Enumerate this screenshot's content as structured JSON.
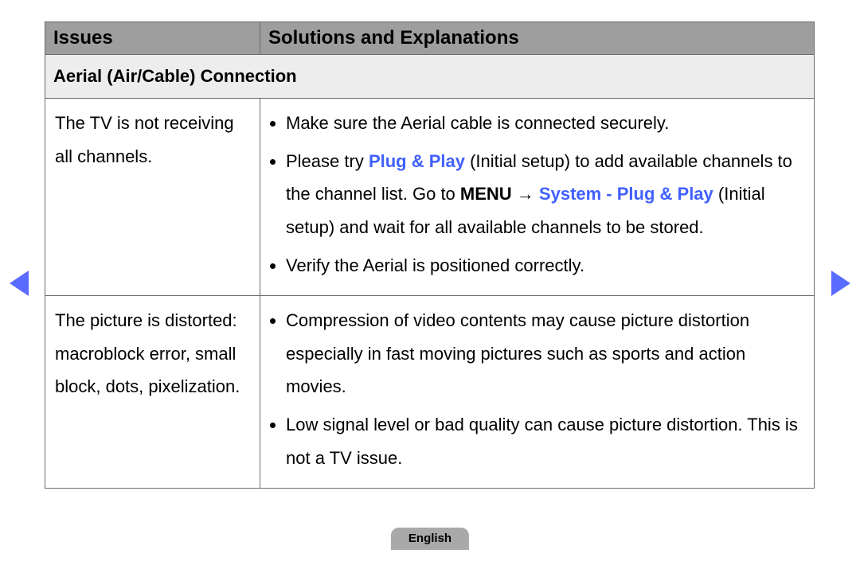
{
  "header": {
    "issues_label": "Issues",
    "solutions_label": "Solutions and Explanations"
  },
  "section": {
    "title": "Aerial (Air/Cable) Connection"
  },
  "rows": [
    {
      "issue": "The TV is not receiving all channels.",
      "bullets": [
        {
          "text": "Make sure the Aerial cable is connected securely."
        },
        {
          "pre": "Please try ",
          "hl1": "Plug & Play",
          "mid": " (Initial setup) to add available channels to the channel list. Go to ",
          "menu": "MENU",
          "arrow": " → ",
          "hl2": "System - Plug & Play",
          "post": " (Initial setup) and wait for all available channels to be stored."
        },
        {
          "text": "Verify the Aerial is positioned correctly."
        }
      ]
    },
    {
      "issue": "The picture is distorted: macroblock error, small block, dots, pixelization.",
      "bullets": [
        {
          "text": "Compression of video contents may cause picture distortion especially in fast moving pictures such as sports and action movies."
        },
        {
          "text": "Low signal level or bad quality can cause picture distortion. This is not a TV issue."
        }
      ]
    }
  ],
  "nav": {
    "left_name": "previous-page",
    "right_name": "next-page"
  },
  "footer": {
    "language": "English"
  }
}
